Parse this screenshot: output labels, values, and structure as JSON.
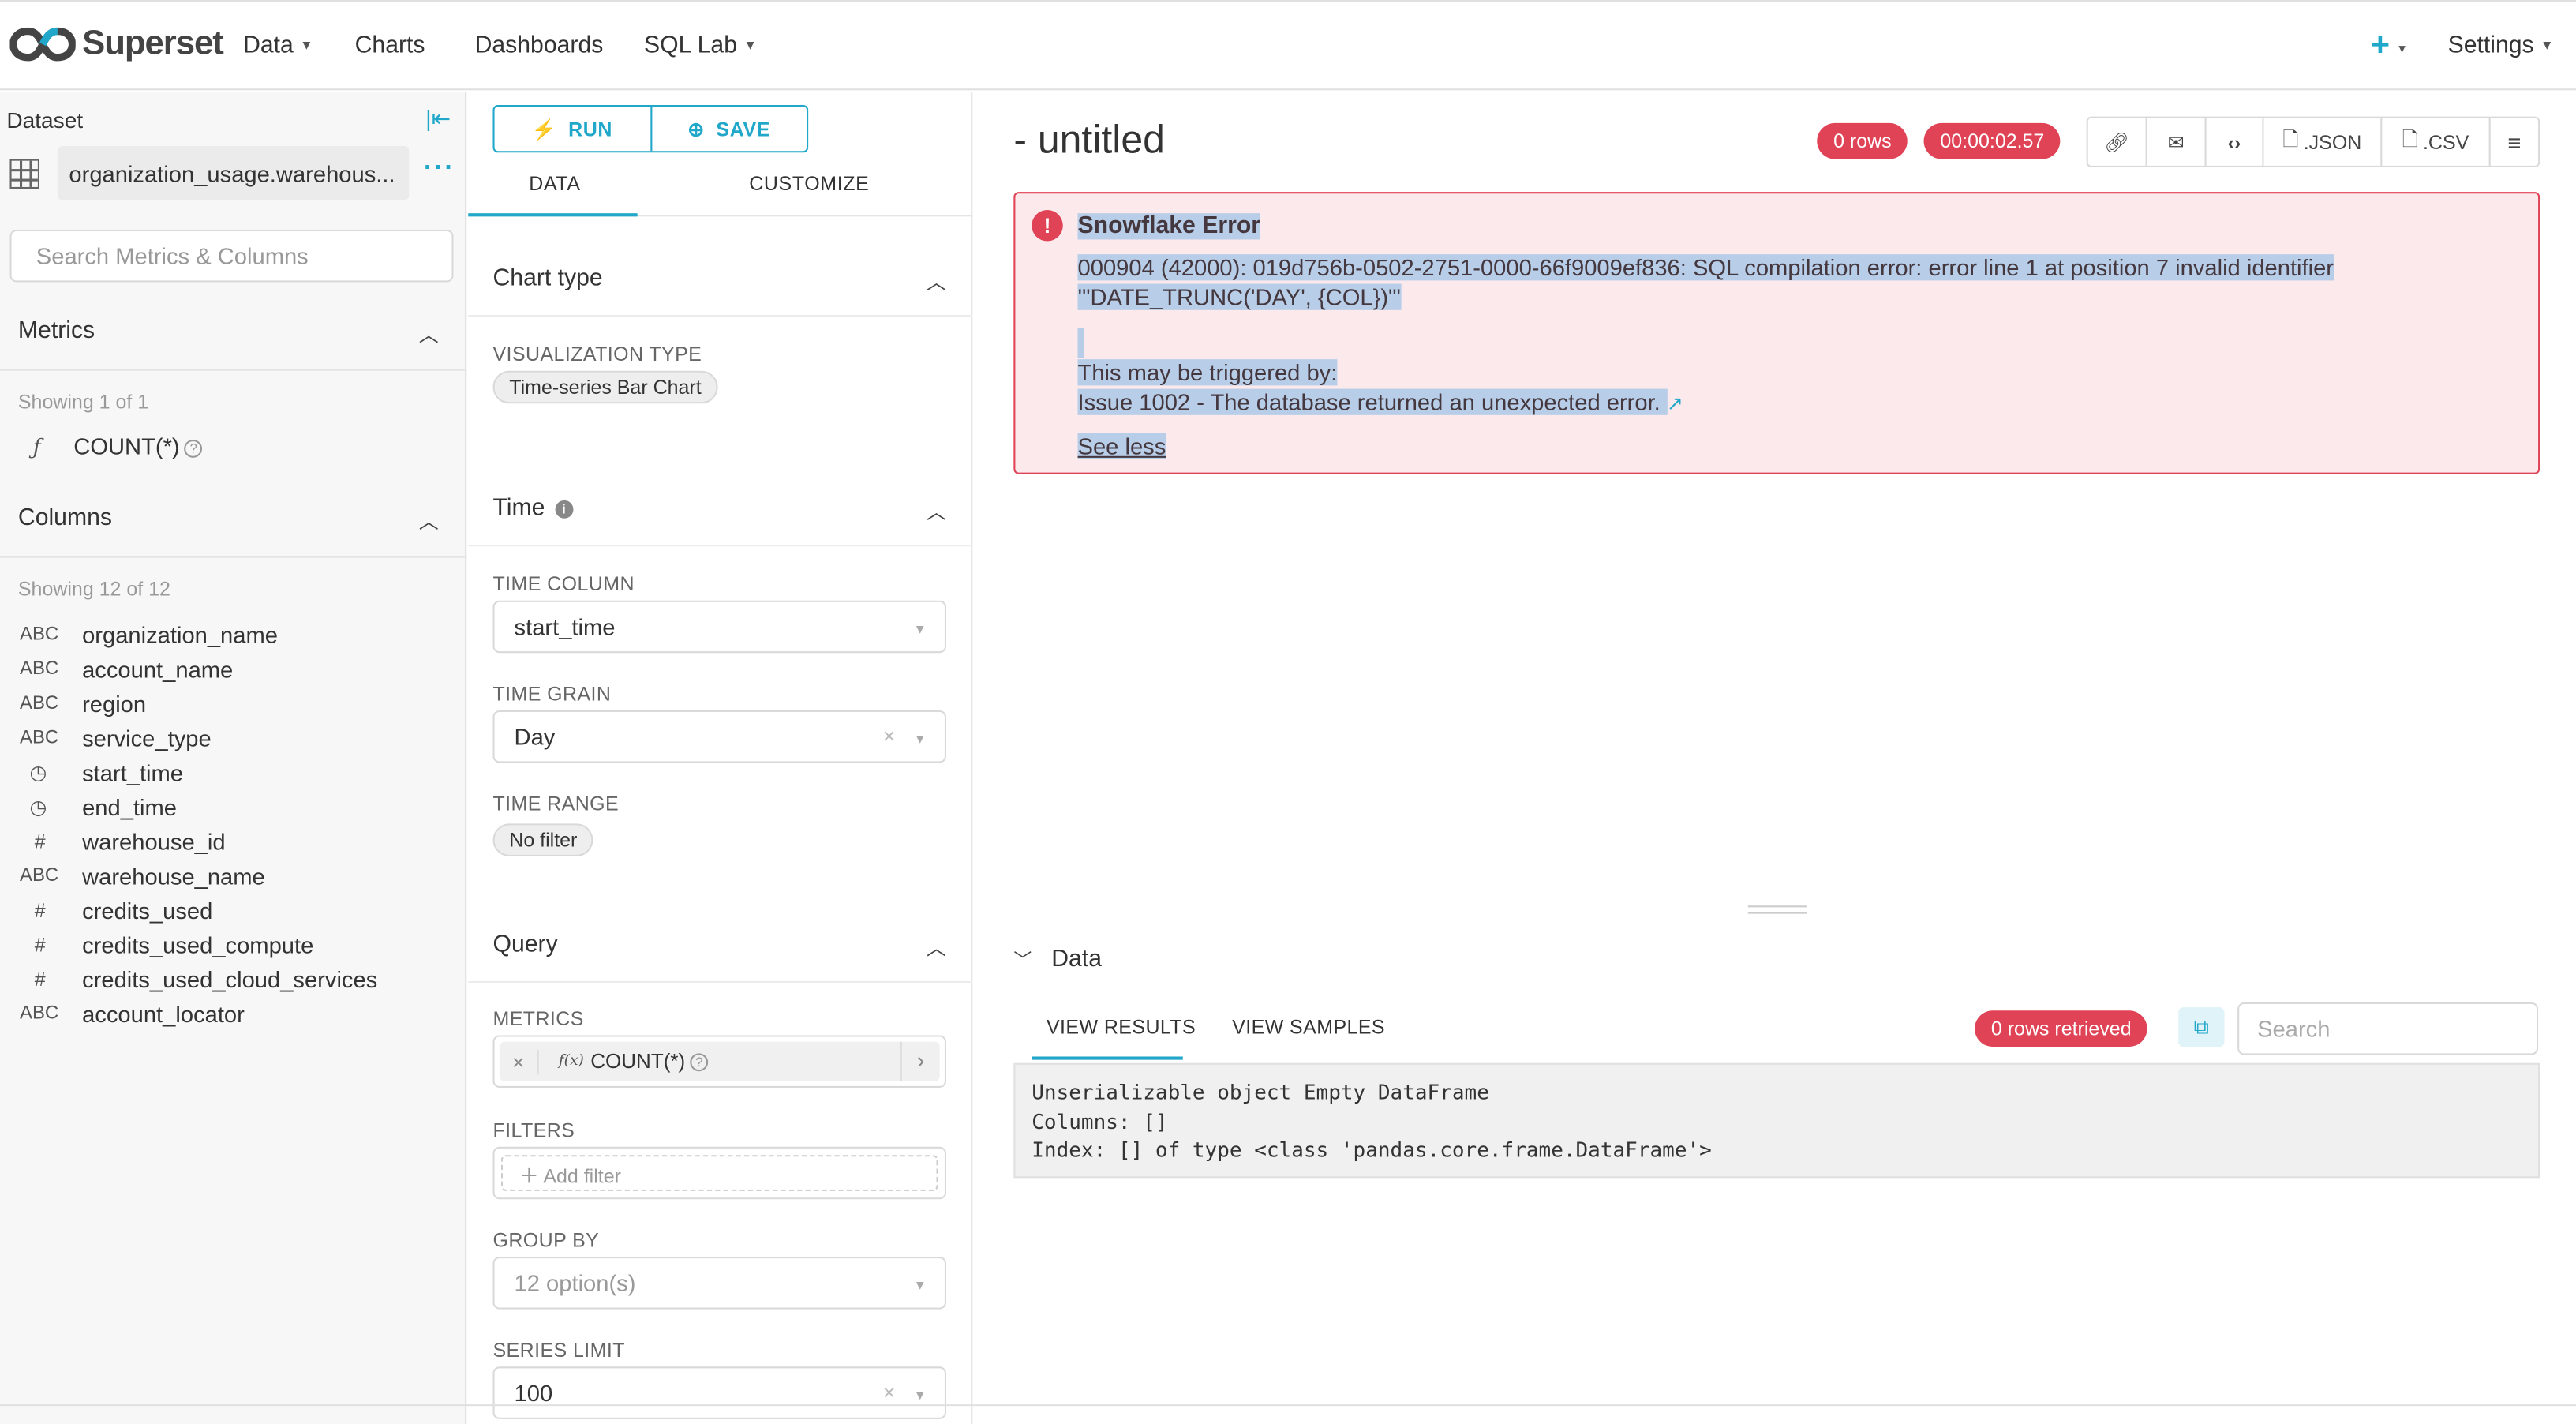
{
  "navbar": {
    "brand": "Superset",
    "menu": [
      {
        "label": "Data",
        "has_caret": true
      },
      {
        "label": "Charts",
        "has_caret": false
      },
      {
        "label": "Dashboards",
        "has_caret": false
      },
      {
        "label": "SQL Lab",
        "has_caret": true
      }
    ],
    "plus_icon": "plus-icon",
    "settings_label": "Settings",
    "accent_color": "#20a7c9"
  },
  "dataset_panel": {
    "title": "Dataset",
    "dataset_name": "organization_usage.warehous...",
    "search_placeholder": "Search Metrics & Columns",
    "metrics_header": "Metrics",
    "metrics_showing": "Showing 1 of 1",
    "metrics": [
      {
        "type_icon": "ƒ",
        "name": "COUNT(*)"
      }
    ],
    "columns_header": "Columns",
    "columns_showing": "Showing 12 of 12",
    "columns": [
      {
        "type": "ABC",
        "name": "organization_name"
      },
      {
        "type": "ABC",
        "name": "account_name"
      },
      {
        "type": "ABC",
        "name": "region"
      },
      {
        "type": "ABC",
        "name": "service_type"
      },
      {
        "type": "clock",
        "name": "start_time"
      },
      {
        "type": "clock",
        "name": "end_time"
      },
      {
        "type": "#",
        "name": "warehouse_id"
      },
      {
        "type": "ABC",
        "name": "warehouse_name"
      },
      {
        "type": "#",
        "name": "credits_used"
      },
      {
        "type": "#",
        "name": "credits_used_compute"
      },
      {
        "type": "#",
        "name": "credits_used_cloud_services"
      },
      {
        "type": "ABC",
        "name": "account_locator"
      }
    ]
  },
  "control_panel": {
    "run_label": "RUN",
    "save_label": "SAVE",
    "tabs": [
      "DATA",
      "CUSTOMIZE"
    ],
    "chart_type_section": "Chart type",
    "viz_type_label": "VISUALIZATION TYPE",
    "viz_type_value": "Time-series Bar Chart",
    "time_section": "Time",
    "time_column_label": "TIME COLUMN",
    "time_column_value": "start_time",
    "time_grain_label": "TIME GRAIN",
    "time_grain_value": "Day",
    "time_range_label": "TIME RANGE",
    "time_range_value": "No filter",
    "query_section": "Query",
    "metrics_label": "METRICS",
    "metric_value": "COUNT(*)",
    "filters_label": "FILTERS",
    "add_filter": "Add filter",
    "group_by_label": "GROUP BY",
    "group_by_value": "12 option(s)",
    "series_limit_label": "SERIES LIMIT",
    "series_limit_value": "100"
  },
  "chart_header": {
    "title": "- untitled",
    "rows_badge": "0 rows",
    "timer_badge": "00:00:02.57",
    "toolbar": {
      "json_label": ".JSON",
      "csv_label": ".CSV"
    }
  },
  "error": {
    "title": "Snowflake Error",
    "message_line1": "000904 (42000): 019d756b-0502-2751-0000-66f9009ef836: SQL compilation error: error line 1 at position 7 invalid identifier",
    "message_line2": "'\"DATE_TRUNC('DAY', {COL})\"'",
    "triggered_by": "This may be triggered by:",
    "issue": "Issue 1002 - The database returned an unexpected error.",
    "see_less": "See less",
    "color": "#e04355"
  },
  "data_pane": {
    "header": "Data",
    "tabs": [
      "VIEW RESULTS",
      "VIEW SAMPLES"
    ],
    "rows_retrieved": "0 rows retrieved",
    "search_placeholder": "Search",
    "result_text": "Unserializable object Empty DataFrame\nColumns: []\nIndex: [] of type <class 'pandas.core.frame.DataFrame'>"
  }
}
